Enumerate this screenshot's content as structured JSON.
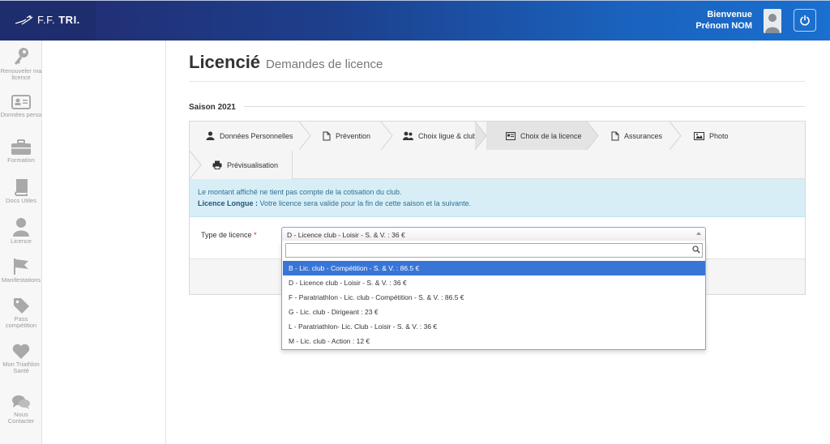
{
  "header": {
    "logo_ff": "F.F.",
    "logo_tri": "TRI.",
    "welcome_line1": "Bienvenue",
    "welcome_line2": "Prénom NOM",
    "colors": {
      "header_dark": "#232a6e",
      "header_light": "#1a6fcf"
    }
  },
  "sidebar": {
    "items": [
      {
        "label": "Renouveler ma licence",
        "icon": "key-icon"
      },
      {
        "label": "Données perso",
        "icon": "id-card-icon"
      },
      {
        "label": "Formation",
        "icon": "briefcase-icon"
      },
      {
        "label": "Docs Utiles",
        "icon": "book-icon"
      },
      {
        "label": "Licence",
        "icon": "user-icon"
      },
      {
        "label": "Manifestations",
        "icon": "flag-icon"
      },
      {
        "label": "Pass compétition",
        "icon": "tag-icon"
      },
      {
        "label": "Mon Triathlon Santé",
        "icon": "heart-icon"
      },
      {
        "label": "Nous Contacter",
        "icon": "chat-icon"
      }
    ]
  },
  "main": {
    "title": "Licencié",
    "subtitle": "Demandes de licence",
    "season": "Saison 2021",
    "tabs": [
      {
        "label": "Données Personnelles",
        "icon": "user-icon"
      },
      {
        "label": "Prévention",
        "icon": "document-icon"
      },
      {
        "label": "Choix ligue & club",
        "icon": "users-icon"
      },
      {
        "label": "Choix de la licence",
        "icon": "card-icon",
        "active": true
      },
      {
        "label": "Assurances",
        "icon": "document-icon"
      },
      {
        "label": "Photo",
        "icon": "image-icon"
      },
      {
        "label": "Prévisualisation",
        "icon": "print-icon"
      }
    ],
    "info_line1": "Le montant affiché ne tient pas compte de la cotisation du club.",
    "info_bold": "Licence Longue :",
    "info_line2": " Votre licence sera valide pour la fin de cette saison et la suivante.",
    "form_label": "Type de licence",
    "required_mark": "*",
    "select_value": "D - Licence club - Loisir - S. & V. : 36 €",
    "search_value": "",
    "options": [
      {
        "label": "B - Lic. club - Compétition - S. & V. : 86.5 €",
        "highlighted": true
      },
      {
        "label": "D - Licence club - Loisir - S. & V. : 36 €"
      },
      {
        "label": "F - Paratriathlon - Lic. club - Compétition - S. & V. : 86.5 €"
      },
      {
        "label": "G - Lic. club - Dirigeant : 23 €"
      },
      {
        "label": "L - Paratriathlon- Lic. Club - Loisir - S. & V. : 36 €"
      },
      {
        "label": "M - Lic. club - Action : 12 €"
      }
    ],
    "colors": {
      "info_bg": "#d7eef7",
      "info_text": "#31708f",
      "highlight": "#3875d7"
    }
  }
}
